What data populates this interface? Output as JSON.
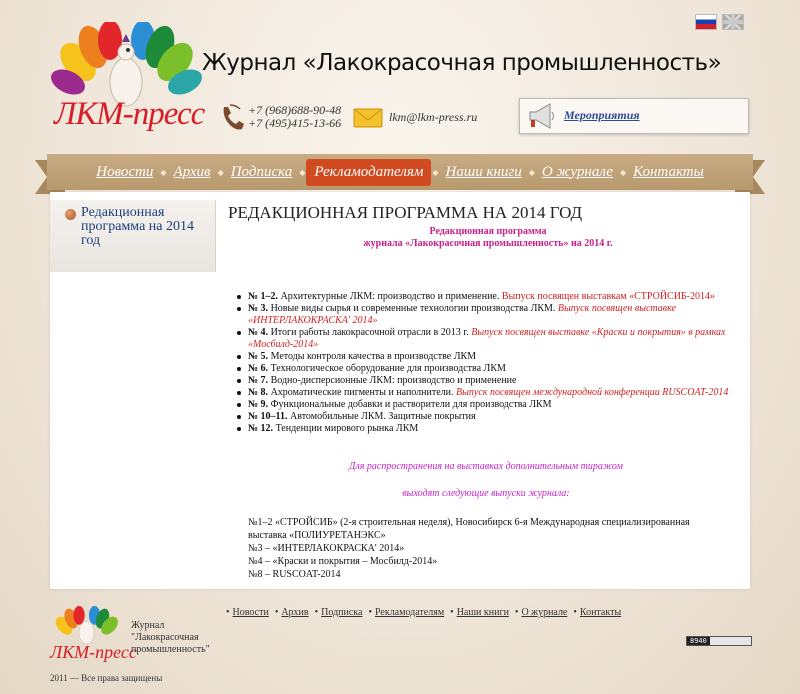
{
  "header": {
    "flags": [
      {
        "name": "russian-flag-icon"
      },
      {
        "name": "uk-flag-icon"
      }
    ],
    "logo_text": "ЛКМ-пресс",
    "title": "Журнал «Лакокрасочная промышленность»",
    "phones": [
      "+7 (968)688-90-48",
      "+7 (495)415-13-66"
    ],
    "email": "lkm@lkm-press.ru",
    "events_link": "Мероприятия"
  },
  "nav": {
    "items": [
      {
        "label": "Новости"
      },
      {
        "label": "Архив"
      },
      {
        "label": "Подписка"
      },
      {
        "label": "Рекламодателям",
        "active": true
      },
      {
        "label": "Наши книги"
      },
      {
        "label": "О журнале"
      },
      {
        "label": "Контакты"
      }
    ]
  },
  "sidebar": {
    "items": [
      {
        "label": "Редакционная программа на 2014 год"
      }
    ]
  },
  "main": {
    "heading": "РЕДАКЦИОННАЯ ПРОГРАММА НА 2014 ГОД",
    "subheading_line1": "Редакционная программа",
    "subheading_line2": "журнала «Лакокрасочная промышленность» на 2014 г.",
    "issues": [
      {
        "num": "№ 1–2.",
        "text": " Архитектурные ЛКМ: производство и применение. ",
        "note": "Выпуск посвящен выставкам «СТРОЙСИБ-2014»",
        "note_italic": false
      },
      {
        "num": "№ 3.",
        "text": " Новые виды сырья и современные технологии производства ЛКМ. ",
        "note": "Выпуск посвящен выставке «ИНТЕРЛАКОКРАСКА' 2014»",
        "note_italic": true
      },
      {
        "num": "№ 4.",
        "text": " Итоги работы лакокрасочной отрасли в 2013 г. ",
        "note": "Выпуск посвящен выставке «Краски и покрытия» в рамках «Мосбилд-2014»",
        "note_italic": true
      },
      {
        "num": "№ 5.",
        "text": " Методы контроля качества в производстве ЛКМ",
        "note": "",
        "note_italic": false
      },
      {
        "num": "№ 6.",
        "text": " Технологическое оборудование для производства ЛКМ",
        "note": "",
        "note_italic": false
      },
      {
        "num": "№ 7.",
        "text": " Водно-дисперсионные ЛКМ: производство и применение",
        "note": "",
        "note_italic": false
      },
      {
        "num": "№ 8.",
        "text": " Ахроматические пигменты и наполнители. ",
        "note": "Выпуск посвящен международной конференции RUSCOAT-2014",
        "note_italic": true
      },
      {
        "num": "№ 9.",
        "text": " Функциональные добавки и растворители для производства ЛКМ",
        "note": "",
        "note_italic": false
      },
      {
        "num": "№ 10–11.",
        "text": " Автомобильные ЛКМ. Защитные покрытия",
        "note": "",
        "note_italic": false
      },
      {
        "num": "№ 12.",
        "text": " Тенденции мирового рынка ЛКМ",
        "note": "",
        "note_italic": false
      }
    ],
    "distribution_line1": "Для распространения на выставках дополнительным тиражом",
    "distribution_line2": "выходят следующие выпуски журнала:",
    "extras": [
      "№1–2 «СТРОЙСИБ» (2-я строительная неделя), Новосибирск 6-я Международная специализированная выставка «ПОЛИУРЕТАНЭКС»",
      "№3 – «ИНТЕРЛАКОКРАСКА' 2014»",
      "№4 – «Краски и покрытия – Мосбилд-2014»",
      "№8 – RUSCOAT-2014"
    ]
  },
  "footer": {
    "logo_text": "ЛКМ-пресс",
    "journal_line1": "Журнал",
    "journal_line2": "\"Лакокрасочная",
    "journal_line3": "промышленность\"",
    "nav": [
      "Новости",
      "Архив",
      "Подписка",
      "Рекламодателям",
      "Наши книги",
      "О журнале",
      "Контакты"
    ],
    "counter": "8940",
    "copyright": "2011 — Все права защищены"
  },
  "colors": {
    "accent": "#d24a20",
    "logo_red": "#d71d27",
    "magenta": "#c81f8c",
    "note_red": "#d32020",
    "link_blue": "#1b3f7e"
  }
}
